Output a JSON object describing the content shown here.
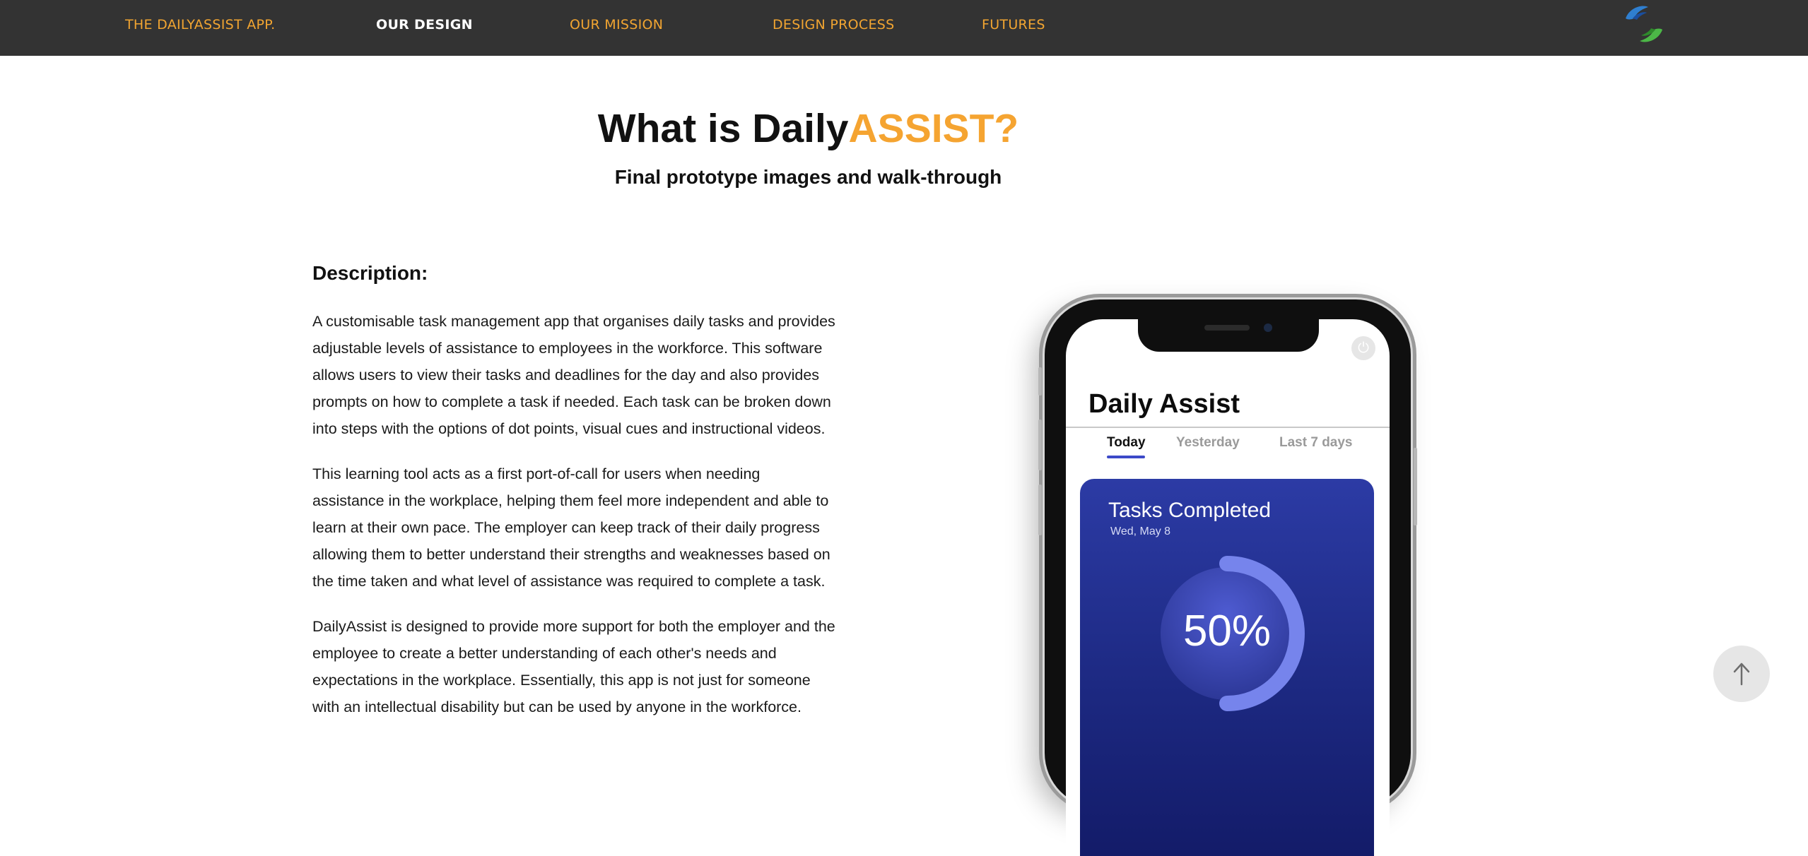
{
  "nav": {
    "items": [
      {
        "label": "THE DAILYASSIST APP.",
        "active": false
      },
      {
        "label": "OUR DESIGN",
        "active": true
      },
      {
        "label": "OUR MISSION",
        "active": false
      },
      {
        "label": "DESIGN PROCESS",
        "active": false
      },
      {
        "label": "FUTURES",
        "active": false
      }
    ],
    "colors": {
      "background": "#333333",
      "link": "#f2a531",
      "active": "#ffffff"
    },
    "logo_icon": "twin-swoosh-logo-icon"
  },
  "heading": {
    "title_prefix": "What is Daily",
    "title_accent": "ASSIST?",
    "accent_color": "#f5a431",
    "subtitle": "Final prototype images and walk-through"
  },
  "description": {
    "heading": "Description:",
    "paragraphs": [
      "A customisable task management app that organises daily tasks and provides adjustable levels of assistance to employees in the workforce. This software allows users to view their tasks and deadlines for the day and also provides prompts on how to complete a task if needed. Each task can be broken down into steps with the options of dot points, visual cues and instructional videos.",
      "This learning tool acts as a first port-of-call for users when needing assistance in the workplace, helping them feel more independent and able to learn at their own pace. The employer can keep track of their daily progress allowing them to better understand their strengths and weaknesses based on the time taken and what level of assistance was required to complete a task.",
      "DailyAssist is designed to provide more support for both the employer and the employee to create a better understanding of each other's needs and expectations in the workplace. Essentially, this app is not just for someone with an intellectual disability but can be used by anyone in the workforce."
    ]
  },
  "phone": {
    "power_icon": "power-icon",
    "app_title": "Daily Assist",
    "tabs": [
      {
        "label": "Today",
        "active": true
      },
      {
        "label": "Yesterday",
        "active": false
      },
      {
        "label": "Last 7 days",
        "active": false
      }
    ],
    "card": {
      "title": "Tasks Completed",
      "date": "Wed, May 8",
      "progress_label": "50%",
      "progress": 0.5
    }
  },
  "back_to_top": {
    "icon": "arrow-up-icon"
  }
}
